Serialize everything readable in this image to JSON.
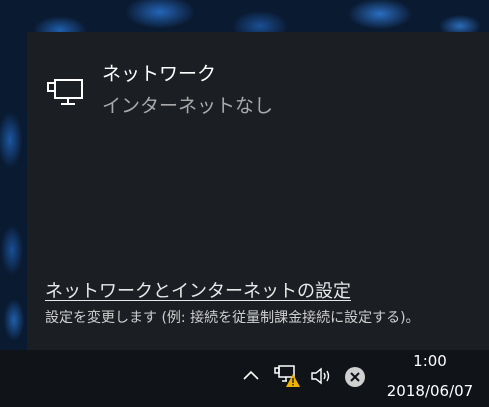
{
  "flyout": {
    "network_name": "ネットワーク",
    "network_status": "インターネットなし",
    "settings_link": "ネットワークとインターネットの設定",
    "settings_description": "設定を変更します (例: 接続を従量制課金接続に設定する)。"
  },
  "taskbar": {
    "time": "1:00",
    "date": "2018/06/07",
    "tray_icons": [
      "chevron-up-icon",
      "network-warning-icon",
      "volume-icon",
      "close-circle-icon"
    ]
  },
  "colors": {
    "flyout_bg": "#1b1f24",
    "taskbar_bg": "#101419",
    "warning": "#f0b400"
  }
}
